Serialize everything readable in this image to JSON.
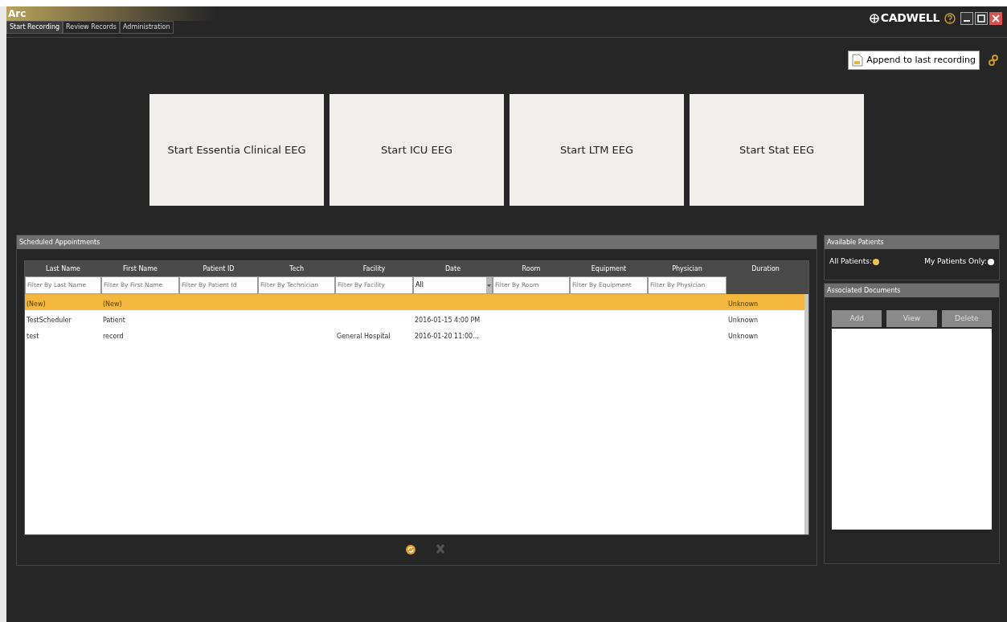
{
  "window": {
    "title": "Arc",
    "brand": "CADWELL"
  },
  "tabs": [
    {
      "label": "Start Recording",
      "selected": true
    },
    {
      "label": "Review Records",
      "selected": false
    },
    {
      "label": "Administration",
      "selected": false
    }
  ],
  "append_button": "Append to last recording",
  "start_buttons": [
    "Start Essentia Clinical EEG",
    "Start ICU EEG",
    "Start LTM EEG",
    "Start Stat EEG"
  ],
  "appointments": {
    "title": "Scheduled Appointments",
    "columns": [
      "Last Name",
      "First Name",
      "Patient ID",
      "Tech",
      "Facility",
      "Date",
      "Room",
      "Equipment",
      "Physician",
      "Duration"
    ],
    "filters": [
      {
        "kind": "text",
        "placeholder": "Filter By Last Name"
      },
      {
        "kind": "text",
        "placeholder": "Filter By First Name"
      },
      {
        "kind": "text",
        "placeholder": "Filter By Patient Id"
      },
      {
        "kind": "text",
        "placeholder": "Filter By Technician"
      },
      {
        "kind": "text",
        "placeholder": "Filter By Facility"
      },
      {
        "kind": "select",
        "value": "All"
      },
      {
        "kind": "text",
        "placeholder": "Filter By Room"
      },
      {
        "kind": "text",
        "placeholder": "Filter By Equipment"
      },
      {
        "kind": "text",
        "placeholder": "Filter By Physician"
      }
    ],
    "rows": [
      {
        "selected": true,
        "cells": [
          "(New)",
          "(New)",
          "",
          "",
          "",
          "",
          "",
          "",
          "",
          "Unknown"
        ]
      },
      {
        "selected": false,
        "cells": [
          "TestScheduler",
          "Patient",
          "",
          "",
          "",
          "2016-01-15 4:00 PM",
          "",
          "",
          "",
          "Unknown"
        ]
      },
      {
        "selected": false,
        "cells": [
          "test",
          "record",
          "",
          "",
          "General Hospital",
          "2016-01-20 11:00...",
          "",
          "",
          "",
          "Unknown"
        ]
      }
    ]
  },
  "available_patients": {
    "title": "Available Patients",
    "options": [
      {
        "label": "All Patients:",
        "selected": true
      },
      {
        "label": "My Patients Only:",
        "selected": false
      }
    ]
  },
  "associated_documents": {
    "title": "Associated Documents",
    "buttons": [
      "Add",
      "View",
      "Delete"
    ]
  }
}
